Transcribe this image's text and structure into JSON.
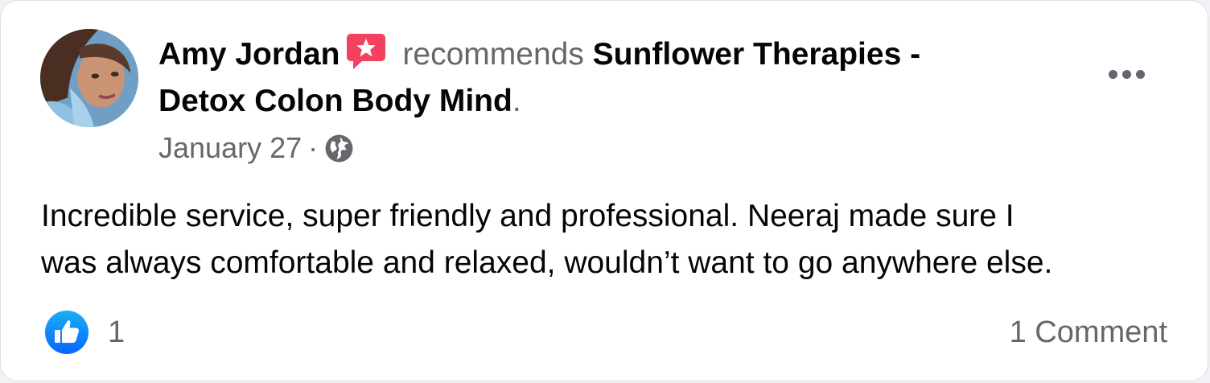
{
  "post": {
    "author": "Amy Jordan",
    "verb": "recommends",
    "page_name_line1": "Sunflower Therapies -",
    "page_name_line2": "Detox Colon Body Mind",
    "page_name_period": ".",
    "date": "January 27",
    "separator": "·",
    "audience_icon": "globe-icon",
    "recommend_icon": "recommend-star-icon",
    "more_icon": "more-options-icon",
    "body_line1": "Incredible service, super friendly and professional. Neeraj made sure I",
    "body_line2": "was always comfortable and relaxed, wouldn’t want to go anywhere else."
  },
  "footer": {
    "reaction_icon": "like-icon",
    "reaction_count": "1",
    "comments": "1 Comment"
  },
  "colors": {
    "primary_text": "#050505",
    "secondary_text": "#65676b",
    "like_blue": "#1877f2",
    "recommend_red": "#f3425f",
    "card_background": "#ffffff"
  }
}
